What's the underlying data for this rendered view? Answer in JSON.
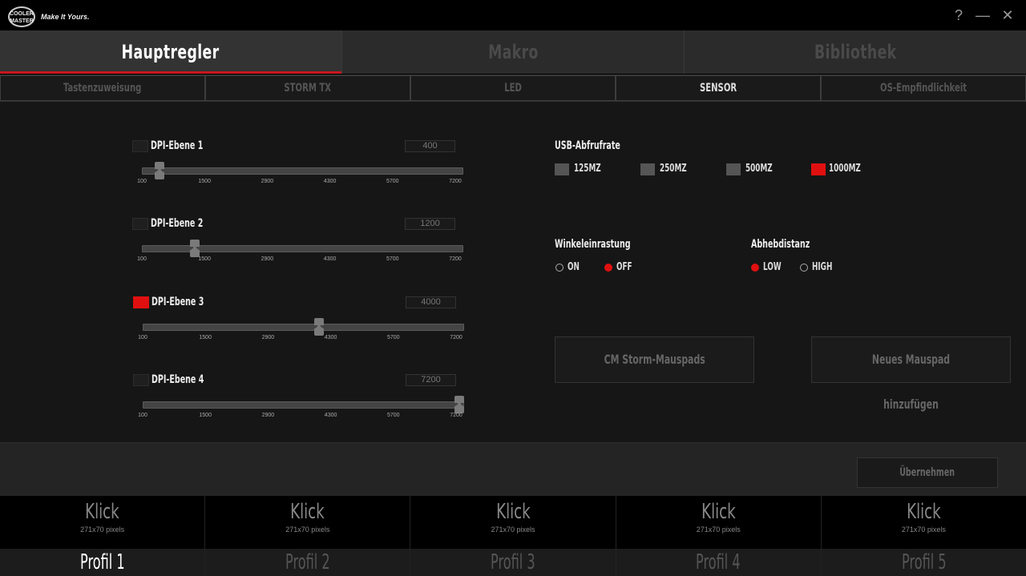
{
  "titlebar": {
    "logo_text": "COOLER MASTER",
    "tagline": "Make It Yours.",
    "help": "?",
    "minimize": "—",
    "close": "✕"
  },
  "main_tabs": [
    "Hauptregler",
    "Makro",
    "Bibliothek"
  ],
  "active_main_tab": 0,
  "sub_tabs": [
    "Tastenzuweisung",
    "STORM TX",
    "LED",
    "SENSOR",
    "OS-Empfindlichkeit"
  ],
  "active_sub_tab": 3,
  "dpi": {
    "ticks": [
      "100",
      "1500",
      "2900",
      "4300",
      "5700",
      "7200"
    ],
    "min": 100,
    "max": 7200,
    "levels": [
      {
        "label": "DPI-Ebene 1",
        "value": "400",
        "enabled": false
      },
      {
        "label": "DPI-Ebene 2",
        "value": "1200",
        "enabled": false
      },
      {
        "label": "DPI-Ebene 3",
        "value": "4000",
        "enabled": true
      },
      {
        "label": "DPI-Ebene 4",
        "value": "7200",
        "enabled": false
      }
    ]
  },
  "usb": {
    "title": "USB-Abfrufrate",
    "options": [
      {
        "label": "125MZ",
        "selected": false
      },
      {
        "label": "250MZ",
        "selected": false
      },
      {
        "label": "500MZ",
        "selected": false
      },
      {
        "label": "1000MZ",
        "selected": true
      }
    ]
  },
  "angle_snap": {
    "title": "Winkeleinrastung",
    "options": [
      {
        "label": "ON",
        "selected": false
      },
      {
        "label": "OFF",
        "selected": true
      }
    ]
  },
  "lift_off": {
    "title": "Abhebdistanz",
    "options": [
      {
        "label": "LOW",
        "selected": true
      },
      {
        "label": "HIGH",
        "selected": false
      }
    ]
  },
  "buttons": {
    "cm_pads": "CM Storm-Mauspads",
    "new_pad": "Neues Mauspad hinzufügen",
    "apply": "Übernehmen"
  },
  "profiles": [
    {
      "image_text": "Klick",
      "image_size": "271x70 pixels",
      "name": "Profil 1"
    },
    {
      "image_text": "Klick",
      "image_size": "271x70 pixels",
      "name": "Profil 2"
    },
    {
      "image_text": "Klick",
      "image_size": "271x70 pixels",
      "name": "Profil 3"
    },
    {
      "image_text": "Klick",
      "image_size": "271x70 pixels",
      "name": "Profil 4"
    },
    {
      "image_text": "Klick",
      "image_size": "271x70 pixels",
      "name": "Profil 5"
    }
  ],
  "active_profile": 0,
  "colors": {
    "accent": "#e01010",
    "tab_underline": "#c8161d"
  }
}
